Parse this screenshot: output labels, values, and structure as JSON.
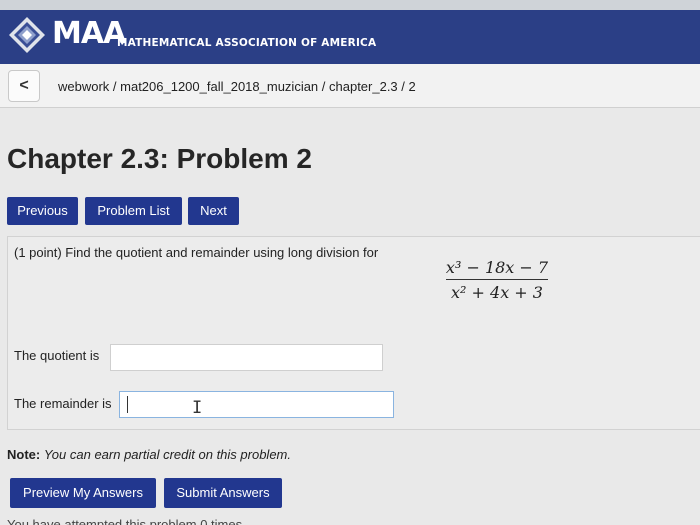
{
  "header": {
    "logo_text": "MAA",
    "subtitle": "MATHEMATICAL ASSOCIATION OF AMERICA"
  },
  "nav": {
    "back_label": "<",
    "breadcrumb": "webwork / mat206_1200_fall_2018_muzician / chapter_2.3 / 2"
  },
  "page_title": "Chapter 2.3: Problem 2",
  "buttons": {
    "previous": "Previous",
    "problem_list": "Problem List",
    "next": "Next",
    "preview": "Preview My Answers",
    "submit": "Submit Answers"
  },
  "problem": {
    "prompt": "(1 point) Find the quotient and remainder using long division for",
    "numerator": "x³ − 18x − 7",
    "denominator": "x² + 4x + 3",
    "quotient_label": "The quotient is",
    "quotient_value": "",
    "remainder_label": "The remainder is",
    "remainder_value": ""
  },
  "note": {
    "label": "Note:",
    "text": "You can earn partial credit on this problem."
  },
  "footer_cutoff": "You have attempted this problem 0 times.",
  "colors": {
    "header_bg": "#2b3f86",
    "button_bg": "#22378f"
  },
  "icons": {
    "logo": "maa-diamond-logo",
    "back": "chevron-left-icon",
    "cursor": "text-cursor-icon"
  }
}
